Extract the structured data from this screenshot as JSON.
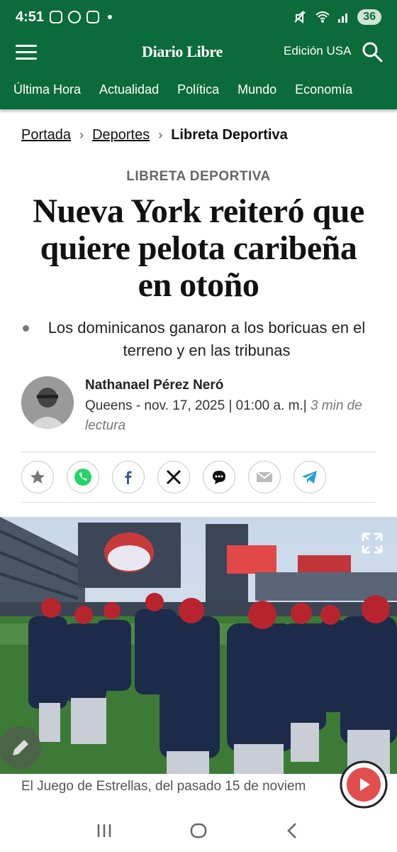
{
  "status": {
    "time": "4:51",
    "battery": "36"
  },
  "header": {
    "logo": "Diario Libre",
    "edition": "Edición USA"
  },
  "nav": {
    "items": [
      "Última Hora",
      "Actualidad",
      "Política",
      "Mundo",
      "Economía"
    ]
  },
  "breadcrumb": {
    "home": "Portada",
    "section": "Deportes",
    "current": "Libreta Deportiva"
  },
  "article": {
    "kicker": "LIBRETA DEPORTIVA",
    "headline": "Nueva York reiteró que quiere pelota caribeña en otoño",
    "subhead": "Los dominicanos ganaron a los boricuas en el terreno y en las tribunas",
    "author": "Nathanael Pérez Neró",
    "meta": "Queens - nov. 17, 2025 | 01:00 a. m.|",
    "read_time": "3 min de lectura",
    "caption": "El Juego de Estrellas, del pasado 15 de noviem"
  },
  "colors": {
    "brand_green": "#0c6b3a",
    "whatsapp": "#25d366",
    "facebook": "#3b5998",
    "telegram": "#2a9fd6"
  }
}
